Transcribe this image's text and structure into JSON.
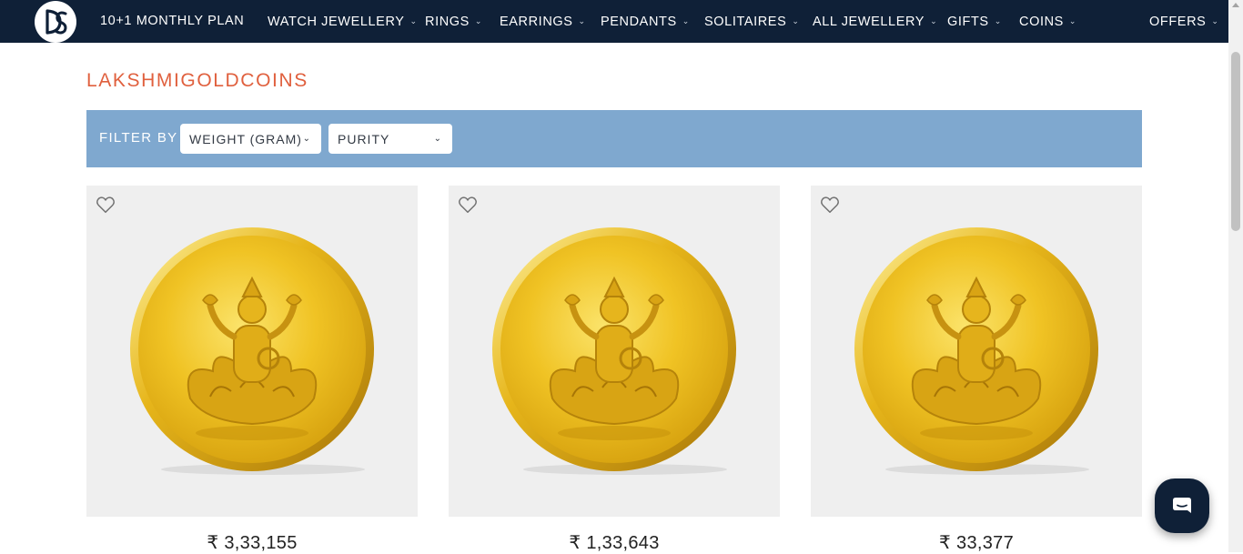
{
  "nav": {
    "logo_alt": "DS",
    "items": [
      {
        "label": "10+1 MONTHLY PLAN",
        "has_dropdown": false
      },
      {
        "label": "WATCH JEWELLERY",
        "has_dropdown": true
      },
      {
        "label": "RINGS",
        "has_dropdown": true
      },
      {
        "label": "EARRINGS",
        "has_dropdown": true
      },
      {
        "label": "PENDANTS",
        "has_dropdown": true
      },
      {
        "label": "SOLITAIRES",
        "has_dropdown": true
      },
      {
        "label": "ALL JEWELLERY",
        "has_dropdown": true
      },
      {
        "label": "GIFTS",
        "has_dropdown": true
      },
      {
        "label": "COINS",
        "has_dropdown": true
      },
      {
        "label": "OFFERS",
        "has_dropdown": true
      }
    ],
    "chevron": "⌄"
  },
  "page": {
    "title": "LAKSHMIGOLDCOINS"
  },
  "filter": {
    "label": "FILTER BY",
    "weight_select": "WEIGHT (GRAM)",
    "purity_select": "PURITY"
  },
  "products": [
    {
      "price": "3,33,155",
      "currency": "₹",
      "image": "lakshmi-gold-coin"
    },
    {
      "price": "1,33,643",
      "currency": "₹",
      "image": "lakshmi-gold-coin"
    },
    {
      "price": "33,377",
      "currency": "₹",
      "image": "lakshmi-gold-coin"
    }
  ],
  "icons": {
    "wishlist": "heart-outline-icon",
    "chat": "chat-bubble-icon",
    "dropdown": "chevron-down-icon"
  },
  "colors": {
    "nav_bg": "#0f2037",
    "title": "#e0603e",
    "filter_bar": "#7fa8cf",
    "card_bg": "#efefef",
    "gold": "#f3c623"
  }
}
